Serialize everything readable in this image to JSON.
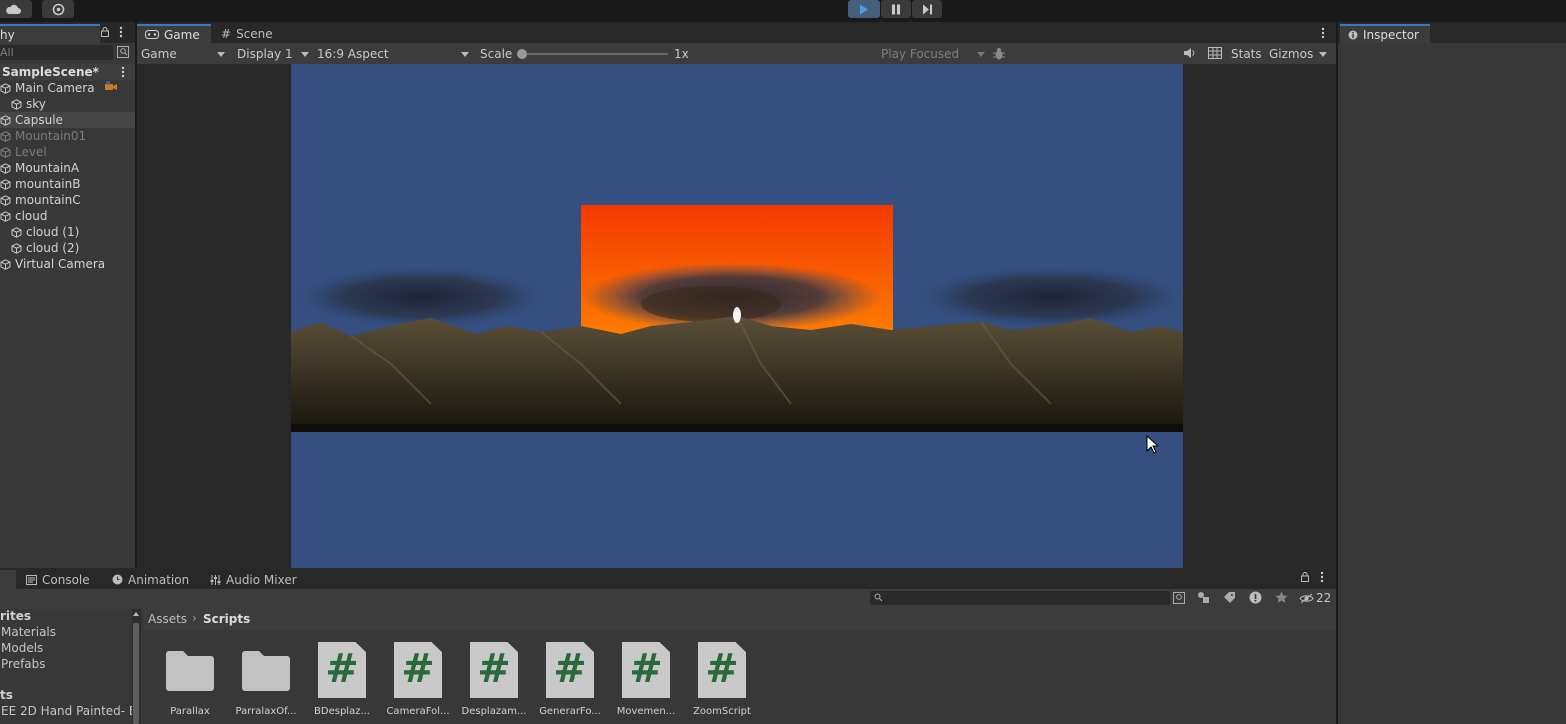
{
  "toolbar": {
    "play_icon": "play-icon",
    "pause_icon": "pause-icon",
    "step_icon": "step-icon",
    "cloud_icon": "cloud-icon",
    "settings_icon": "settings-icon"
  },
  "hierarchy": {
    "tab_label": "hy",
    "search_placeholder": "All",
    "scene_name": "SampleScene*",
    "items": [
      {
        "label": "Main Camera",
        "indent": 0,
        "state": "normal"
      },
      {
        "label": "sky",
        "indent": 1,
        "state": "normal"
      },
      {
        "label": "Capsule",
        "indent": 0,
        "state": "selected"
      },
      {
        "label": "Mountain01",
        "indent": 0,
        "state": "disabled"
      },
      {
        "label": "Level",
        "indent": 0,
        "state": "disabled"
      },
      {
        "label": "MountainA",
        "indent": 0,
        "state": "normal"
      },
      {
        "label": "mountainB",
        "indent": 0,
        "state": "normal"
      },
      {
        "label": "mountainC",
        "indent": 0,
        "state": "normal"
      },
      {
        "label": "cloud",
        "indent": 0,
        "state": "normal"
      },
      {
        "label": "cloud (1)",
        "indent": 1,
        "state": "normal"
      },
      {
        "label": "cloud (2)",
        "indent": 1,
        "state": "normal"
      },
      {
        "label": "Virtual Camera",
        "indent": 0,
        "state": "normal"
      }
    ]
  },
  "game_view": {
    "tabs": [
      {
        "label": "Game",
        "active": true
      },
      {
        "label": "Scene",
        "active": false
      }
    ],
    "view_mode": "Game",
    "display": "Display 1",
    "aspect": "16:9 Aspect",
    "scale_label": "Scale",
    "scale_value": "1x",
    "play_mode": "Play Focused",
    "stats_label": "Stats",
    "gizmos_label": "Gizmos",
    "colors": {
      "sky": "#344f80",
      "sun_top": "#f43800",
      "sun_bottom": "#ff8400",
      "mountain": "#3b3424"
    }
  },
  "inspector": {
    "tab_label": "Inspector"
  },
  "bottom": {
    "tabs": [
      "Console",
      "Animation",
      "Audio Mixer"
    ],
    "hidden_count": "22",
    "breadcrumb": [
      "Assets",
      "Scripts"
    ],
    "sidebar": {
      "favorites_label": "rites",
      "favorites": [
        "Materials",
        "Models",
        "Prefabs"
      ],
      "assets_label": "ts",
      "assets_item": "EE 2D Hand Painted- B"
    },
    "assets": [
      {
        "name": "Parallax",
        "kind": "folder"
      },
      {
        "name": "ParralaxOf...",
        "kind": "folder"
      },
      {
        "name": "BDesplaz...",
        "kind": "script"
      },
      {
        "name": "CameraFol...",
        "kind": "script"
      },
      {
        "name": "Desplazam...",
        "kind": "script"
      },
      {
        "name": "GenerarFo...",
        "kind": "script"
      },
      {
        "name": "Movemen...",
        "kind": "script"
      },
      {
        "name": "ZoomScript",
        "kind": "script"
      }
    ]
  }
}
